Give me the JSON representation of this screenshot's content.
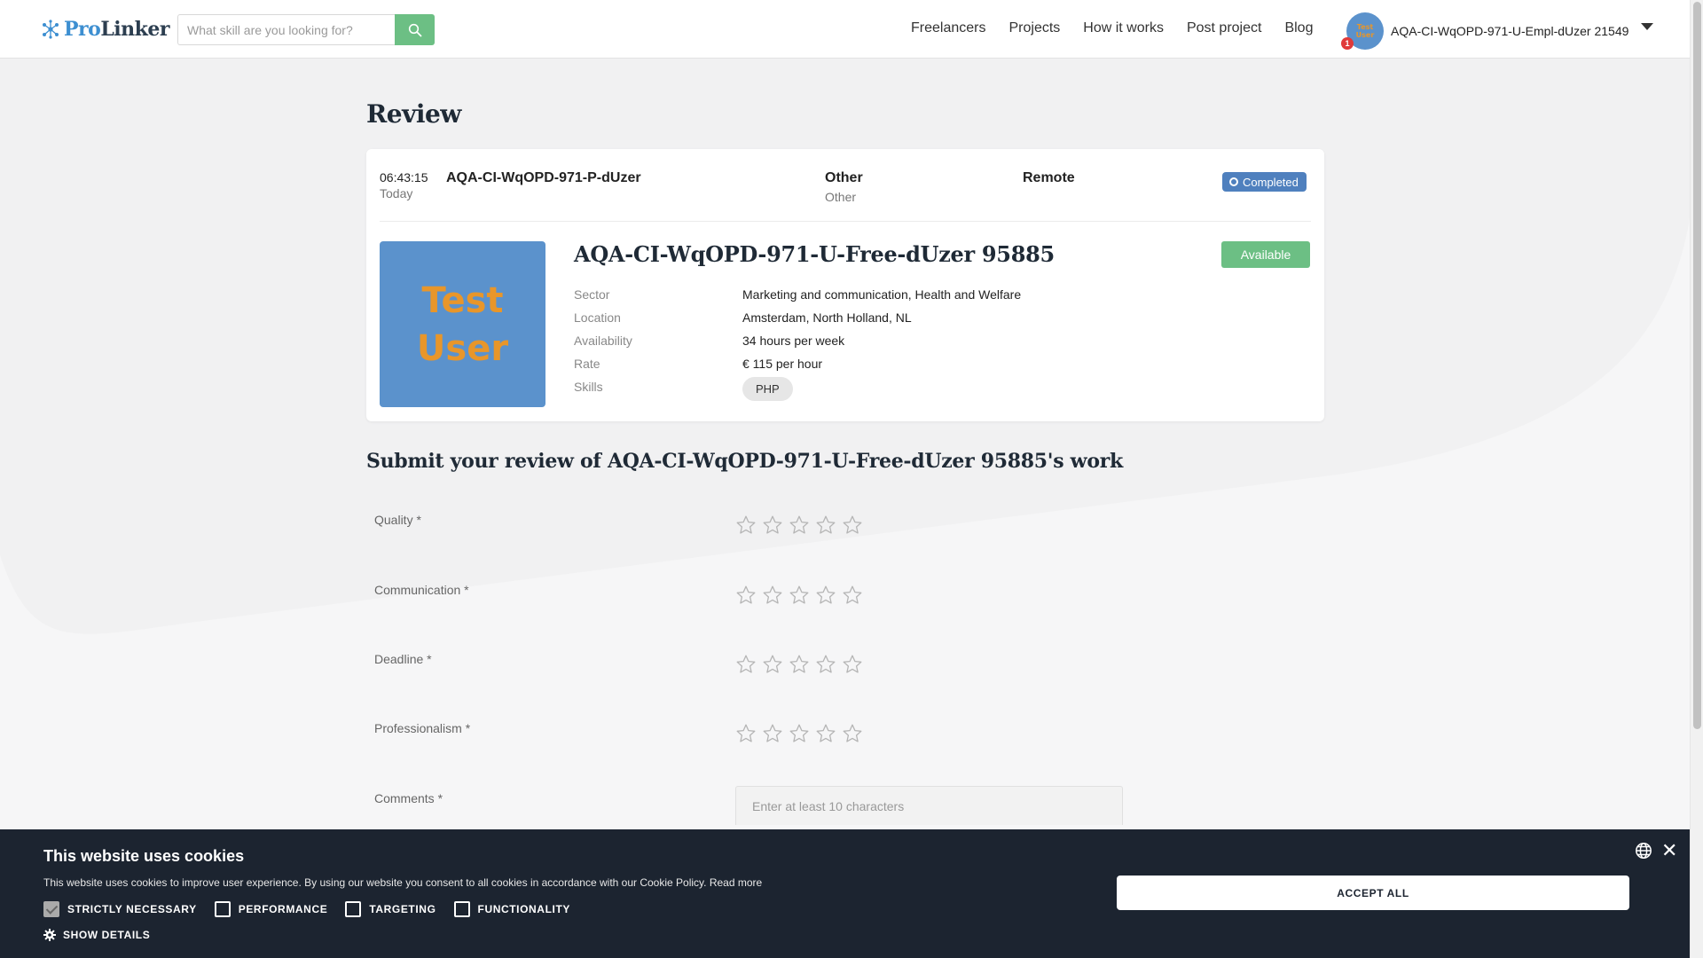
{
  "header": {
    "logo_pro": "Pro",
    "logo_linker": "Linker",
    "search_placeholder": "What skill are you looking for?",
    "nav": [
      "Freelancers",
      "Projects",
      "How it works",
      "Post project",
      "Blog"
    ],
    "user_name": "AQA-CI-WqOPD-971-U-Empl-dUzer 21549",
    "notification_count": "1",
    "avatar_text": "Test User"
  },
  "page": {
    "title": "Review"
  },
  "project": {
    "time": "06:43:15",
    "day": "Today",
    "name": "AQA-CI-WqOPD-971-P-dUzer",
    "category": "Other",
    "subcategory": "Other",
    "work_mode": "Remote",
    "status": "Completed",
    "status_color": "#4f80be"
  },
  "freelancer": {
    "avatar_line1": "Test",
    "avatar_line2": "User",
    "name": "AQA-CI-WqOPD-971-U-Free-dUzer 95885",
    "availability_badge": "Available",
    "availability_color": "#6cbf84",
    "details": [
      {
        "label": "Sector",
        "value": "Marketing and communication, Health and Welfare"
      },
      {
        "label": "Location",
        "value": "Amsterdam, North Holland, NL"
      },
      {
        "label": "Availability",
        "value": "34 hours per week"
      },
      {
        "label": "Rate",
        "value": "€ 115 per hour"
      }
    ],
    "skills_label": "Skills",
    "skills": [
      "PHP"
    ]
  },
  "review": {
    "title": "Submit your review of AQA-CI-WqOPD-971-U-Free-dUzer 95885's work",
    "ratings": [
      {
        "label": "Quality *",
        "value": 0,
        "max": 5
      },
      {
        "label": "Communication *",
        "value": 0,
        "max": 5
      },
      {
        "label": "Deadline *",
        "value": 0,
        "max": 5
      },
      {
        "label": "Professionalism *",
        "value": 0,
        "max": 5
      }
    ],
    "comments_label": "Comments *",
    "comments_placeholder": "Enter at least 10 characters"
  },
  "cookie": {
    "title": "This website uses cookies",
    "text": "This website uses cookies to improve user experience. By using our website you consent to all cookies in accordance with our Cookie Policy.",
    "read_more": "Read more",
    "options": [
      {
        "label": "STRICTLY NECESSARY",
        "checked": true
      },
      {
        "label": "PERFORMANCE",
        "checked": false
      },
      {
        "label": "TARGETING",
        "checked": false
      },
      {
        "label": "FUNCTIONALITY",
        "checked": false
      }
    ],
    "show_details": "SHOW DETAILS",
    "accept_all": "ACCEPT ALL",
    "close": "✕"
  },
  "colors": {
    "accent_green": "#6cbf84",
    "accent_blue": "#4f80be",
    "banner_bg": "#1c2430"
  }
}
